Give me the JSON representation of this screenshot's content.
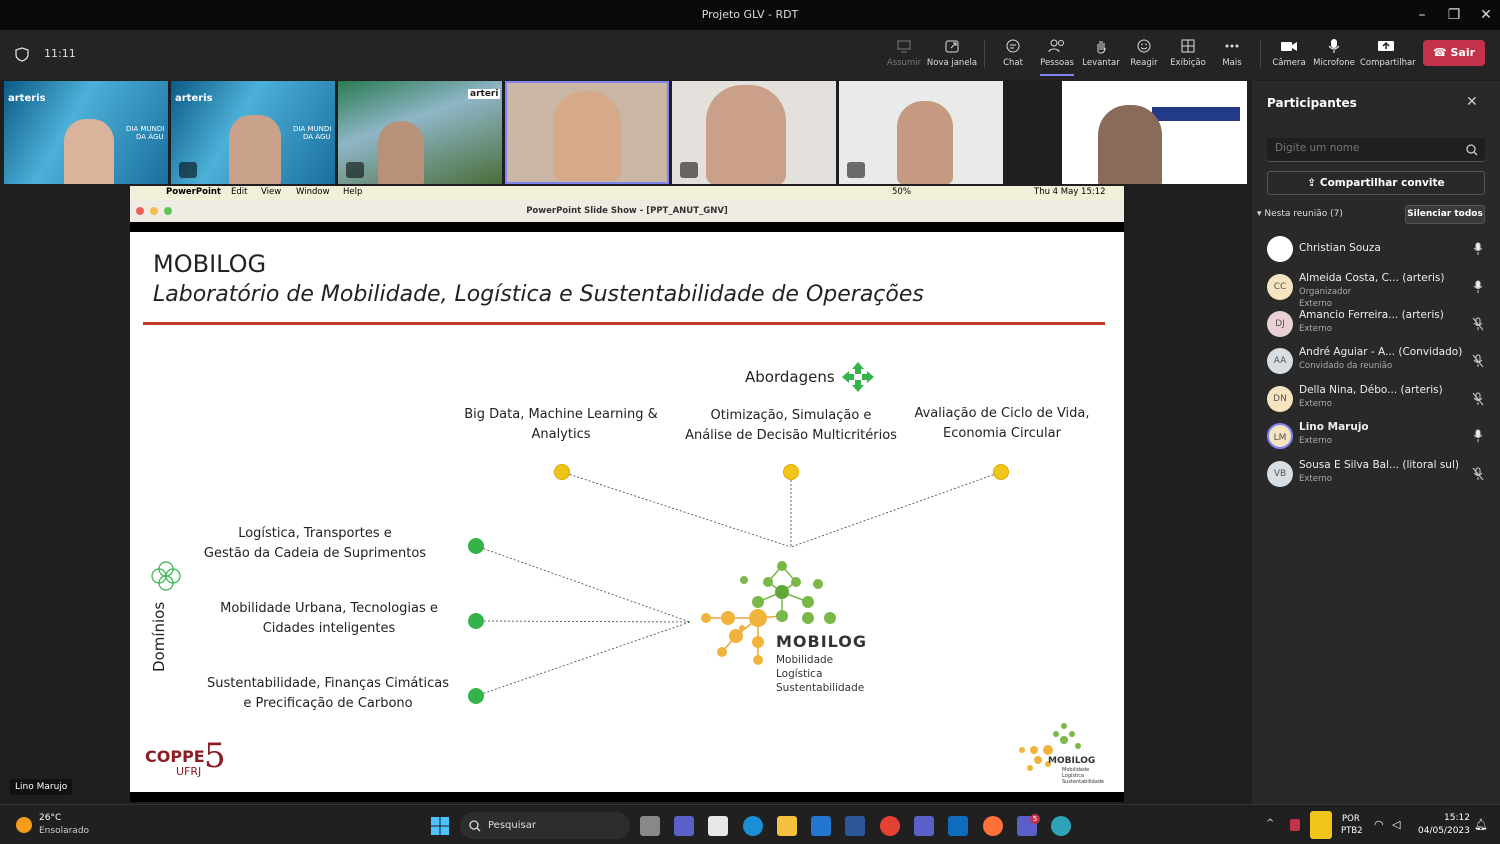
{
  "window": {
    "title": "Projeto GLV - RDT"
  },
  "toolbar": {
    "time": "11:11",
    "assumir": "Assumir",
    "nova_janela": "Nova janela",
    "chat": "Chat",
    "pessoas": "Pessoas",
    "levantar": "Levantar",
    "reagir": "Reagir",
    "exibicao": "Exibição",
    "mais": "Mais",
    "camera": "Câmera",
    "microfone": "Microfone",
    "compartilhar": "Compartilhar",
    "sair": "Sair"
  },
  "thumbs": {
    "arteris": "arteris",
    "dia_mundi": "DIA MUNDI",
    "da_agu": "DA ÁGU",
    "arteris2": "arteri"
  },
  "mac": {
    "apple": "",
    "app": "PowerPoint",
    "edit": "Edit",
    "view": "View",
    "window": "Window",
    "help": "Help",
    "battery": "50%",
    "datetime": "Thu 4 May  15:12",
    "slideshow_title": "PowerPoint Slide Show - [PPT_ANUT_GNV]"
  },
  "slide": {
    "title": "MOBILOG",
    "subtitle": "Laboratório de Mobilidade, Logística e Sustentabilidade de Operações",
    "abordagens": "Abordagens",
    "a1": [
      "Big Data, Machine Learning &",
      "Analytics"
    ],
    "a2": [
      "Otimização, Simulação e",
      "Análise de Decisão Multicritérios"
    ],
    "a3": [
      "Avaliação de Ciclo de Vida,",
      "Economia Circular"
    ],
    "dominios": "Domínios",
    "d1": [
      "Logística, Transportes e",
      "Gestão da Cadeia de Suprimentos"
    ],
    "d2": [
      "Mobilidade Urbana, Tecnologias e",
      "Cidades inteligentes"
    ],
    "d3": [
      "Sustentabilidade, Finanças Cimáticas",
      "e Precificação de Carbono"
    ],
    "logo_name": "MOBILOG",
    "logo_lines": [
      "Mobilidade",
      "Logística",
      "Sustentabilidade"
    ],
    "small_logo_name": "MOBILOG",
    "small_logo_lines": [
      "Mobilidade",
      "Logística",
      "Sustentabilidade"
    ],
    "coppe": "COPPE",
    "ufrj": "UFRJ",
    "coppe_num": "5"
  },
  "speaker_label": "Lino Marujo",
  "panel": {
    "title": "Participantes",
    "search_placeholder": "Digite um nome",
    "invite": "Compartilhar convite",
    "section": "Nesta reunião (7)",
    "mute_all": "Silenciar todos",
    "people": [
      {
        "initials": "",
        "name": "Christian Souza",
        "sub": "",
        "sub2": "",
        "avatar_color": "#ffffff",
        "mic": "on"
      },
      {
        "initials": "CC",
        "name": "Almeida Costa, C... (arteris)",
        "sub": "Organizador",
        "sub2": "Externo",
        "avatar_color": "#f6e3c0",
        "mic": "on"
      },
      {
        "initials": "DJ",
        "name": "Amancio Ferreira... (arteris)",
        "sub": "Externo",
        "sub2": "",
        "avatar_color": "#e8d0d4",
        "mic": "off"
      },
      {
        "initials": "AA",
        "name": "André Aguiar - A... (Convidado)",
        "sub": "Convidado da reunião",
        "sub2": "",
        "avatar_color": "#d6dde3",
        "mic": "off"
      },
      {
        "initials": "DN",
        "name": "Della Nina, Débo... (arteris)",
        "sub": "Externo",
        "sub2": "",
        "avatar_color": "#f6e3c0",
        "mic": "off"
      },
      {
        "initials": "LM",
        "name": "Lino Marujo",
        "sub": "Externo",
        "sub2": "",
        "avatar_color": "#f6e3c0",
        "mic": "on"
      },
      {
        "initials": "VB",
        "name": "Sousa E Silva Bal... (litoral sul)",
        "sub": "Externo",
        "sub2": "",
        "avatar_color": "#d6dde3",
        "mic": "off"
      }
    ]
  },
  "taskbar": {
    "temp": "26°C",
    "weather": "Ensolarado",
    "search": "Pesquisar",
    "lang1": "POR",
    "lang2": "PTB2",
    "time": "15:12",
    "date": "04/05/2023",
    "badge": "5"
  }
}
